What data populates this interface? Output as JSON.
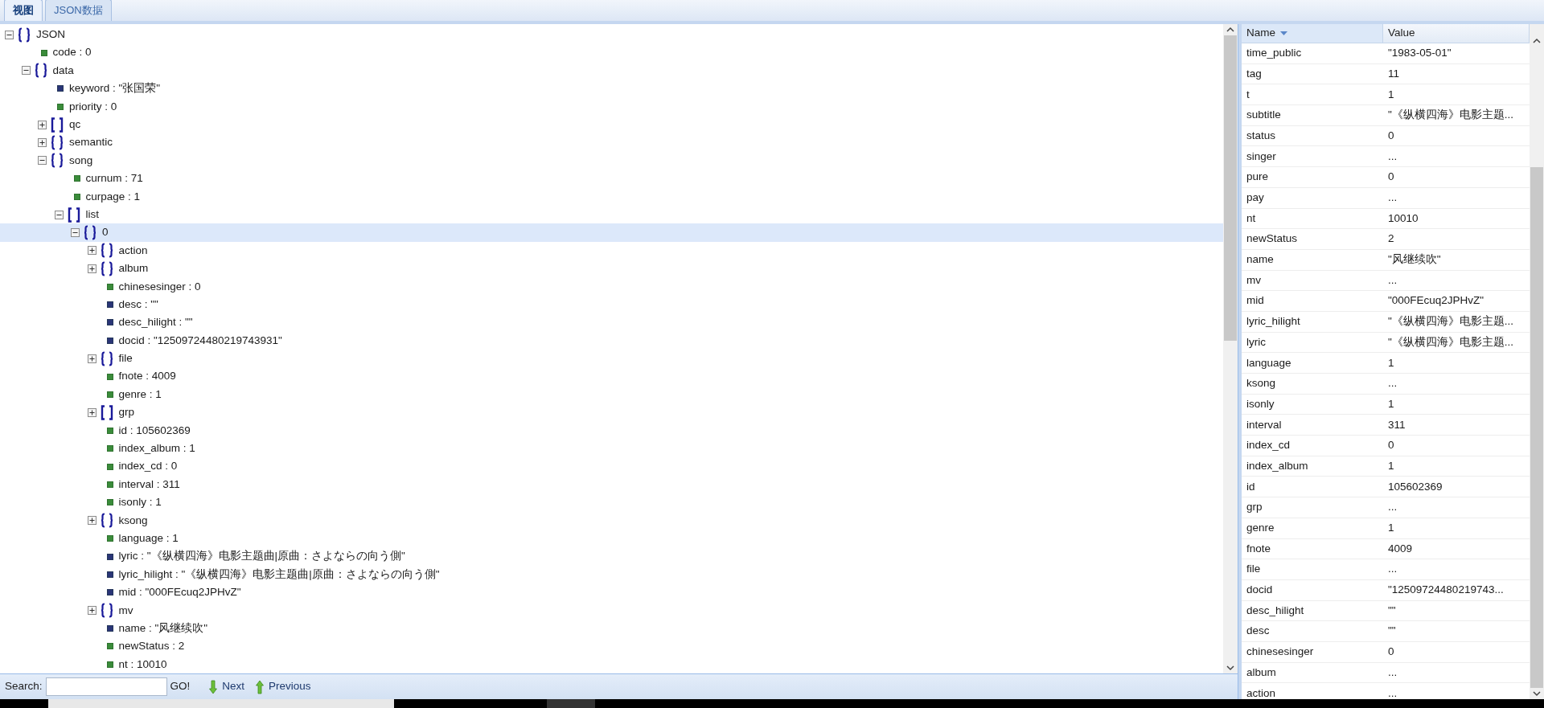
{
  "tabs": [
    {
      "label": "视图",
      "selected": true
    },
    {
      "label": "JSON数据",
      "selected": false
    }
  ],
  "tree": [
    {
      "kind": "object",
      "label": "JSON",
      "expanded": true,
      "selected": false,
      "children": [
        {
          "kind": "number",
          "label": "code : 0",
          "selected": false
        },
        {
          "kind": "object",
          "label": "data",
          "expanded": true,
          "selected": false,
          "children": [
            {
              "kind": "string",
              "label": "keyword : \"张国荣\"",
              "selected": false
            },
            {
              "kind": "number",
              "label": "priority : 0",
              "selected": false
            },
            {
              "kind": "array",
              "label": "qc",
              "expanded": false,
              "selected": false
            },
            {
              "kind": "object",
              "label": "semantic",
              "expanded": false,
              "selected": false
            },
            {
              "kind": "object",
              "label": "song",
              "expanded": true,
              "selected": false,
              "children": [
                {
                  "kind": "number",
                  "label": "curnum : 71",
                  "selected": false
                },
                {
                  "kind": "number",
                  "label": "curpage : 1",
                  "selected": false
                },
                {
                  "kind": "array",
                  "label": "list",
                  "expanded": true,
                  "selected": false,
                  "children": [
                    {
                      "kind": "object",
                      "label": "0",
                      "expanded": true,
                      "selected": true,
                      "children": [
                        {
                          "kind": "object",
                          "label": "action",
                          "expanded": false,
                          "selected": false
                        },
                        {
                          "kind": "object",
                          "label": "album",
                          "expanded": false,
                          "selected": false
                        },
                        {
                          "kind": "number",
                          "label": "chinesesinger : 0",
                          "selected": false
                        },
                        {
                          "kind": "string",
                          "label": "desc : \"\"",
                          "selected": false
                        },
                        {
                          "kind": "string",
                          "label": "desc_hilight : \"\"",
                          "selected": false
                        },
                        {
                          "kind": "string",
                          "label": "docid : \"12509724480219743931\"",
                          "selected": false
                        },
                        {
                          "kind": "object",
                          "label": "file",
                          "expanded": false,
                          "selected": false
                        },
                        {
                          "kind": "number",
                          "label": "fnote : 4009",
                          "selected": false
                        },
                        {
                          "kind": "number",
                          "label": "genre : 1",
                          "selected": false
                        },
                        {
                          "kind": "array",
                          "label": "grp",
                          "expanded": false,
                          "selected": false
                        },
                        {
                          "kind": "number",
                          "label": "id : 105602369",
                          "selected": false
                        },
                        {
                          "kind": "number",
                          "label": "index_album : 1",
                          "selected": false
                        },
                        {
                          "kind": "number",
                          "label": "index_cd : 0",
                          "selected": false
                        },
                        {
                          "kind": "number",
                          "label": "interval : 311",
                          "selected": false
                        },
                        {
                          "kind": "number",
                          "label": "isonly : 1",
                          "selected": false
                        },
                        {
                          "kind": "object",
                          "label": "ksong",
                          "expanded": false,
                          "selected": false
                        },
                        {
                          "kind": "number",
                          "label": "language : 1",
                          "selected": false
                        },
                        {
                          "kind": "string",
                          "label": "lyric : \"《纵横四海》电影主题曲|原曲：さよならの向う側\"",
                          "selected": false
                        },
                        {
                          "kind": "string",
                          "label": "lyric_hilight : \"《纵横四海》电影主题曲|原曲：さよならの向う側\"",
                          "selected": false
                        },
                        {
                          "kind": "string",
                          "label": "mid : \"000FEcuq2JPHvZ\"",
                          "selected": false
                        },
                        {
                          "kind": "object",
                          "label": "mv",
                          "expanded": false,
                          "selected": false
                        },
                        {
                          "kind": "string",
                          "label": "name : \"风继续吹\"",
                          "selected": false
                        },
                        {
                          "kind": "number",
                          "label": "newStatus : 2",
                          "selected": false
                        },
                        {
                          "kind": "number",
                          "label": "nt : 10010",
                          "selected": false
                        }
                      ]
                    }
                  ]
                }
              ]
            }
          ]
        }
      ]
    }
  ],
  "search": {
    "label": "Search:",
    "go": "GO!",
    "next": "Next",
    "previous": "Previous"
  },
  "table": {
    "columns": [
      "Name",
      "Value"
    ],
    "rows": [
      [
        "time_public",
        "\"1983-05-01\""
      ],
      [
        "tag",
        "11"
      ],
      [
        "t",
        "1"
      ],
      [
        "subtitle",
        "\"《纵横四海》电影主题..."
      ],
      [
        "status",
        "0"
      ],
      [
        "singer",
        "..."
      ],
      [
        "pure",
        "0"
      ],
      [
        "pay",
        "..."
      ],
      [
        "nt",
        "10010"
      ],
      [
        "newStatus",
        "2"
      ],
      [
        "name",
        "\"风继续吹\""
      ],
      [
        "mv",
        "..."
      ],
      [
        "mid",
        "\"000FEcuq2JPHvZ\""
      ],
      [
        "lyric_hilight",
        "\"《纵横四海》电影主题..."
      ],
      [
        "lyric",
        "\"《纵横四海》电影主题..."
      ],
      [
        "language",
        "1"
      ],
      [
        "ksong",
        "..."
      ],
      [
        "isonly",
        "1"
      ],
      [
        "interval",
        "311"
      ],
      [
        "index_cd",
        "0"
      ],
      [
        "index_album",
        "1"
      ],
      [
        "id",
        "105602369"
      ],
      [
        "grp",
        "..."
      ],
      [
        "genre",
        "1"
      ],
      [
        "fnote",
        "4009"
      ],
      [
        "file",
        "..."
      ],
      [
        "docid",
        "\"12509724480219743..."
      ],
      [
        "desc_hilight",
        "\"\""
      ],
      [
        "desc",
        "\"\""
      ],
      [
        "chinesesinger",
        "0"
      ],
      [
        "album",
        "..."
      ],
      [
        "action",
        "..."
      ]
    ]
  }
}
